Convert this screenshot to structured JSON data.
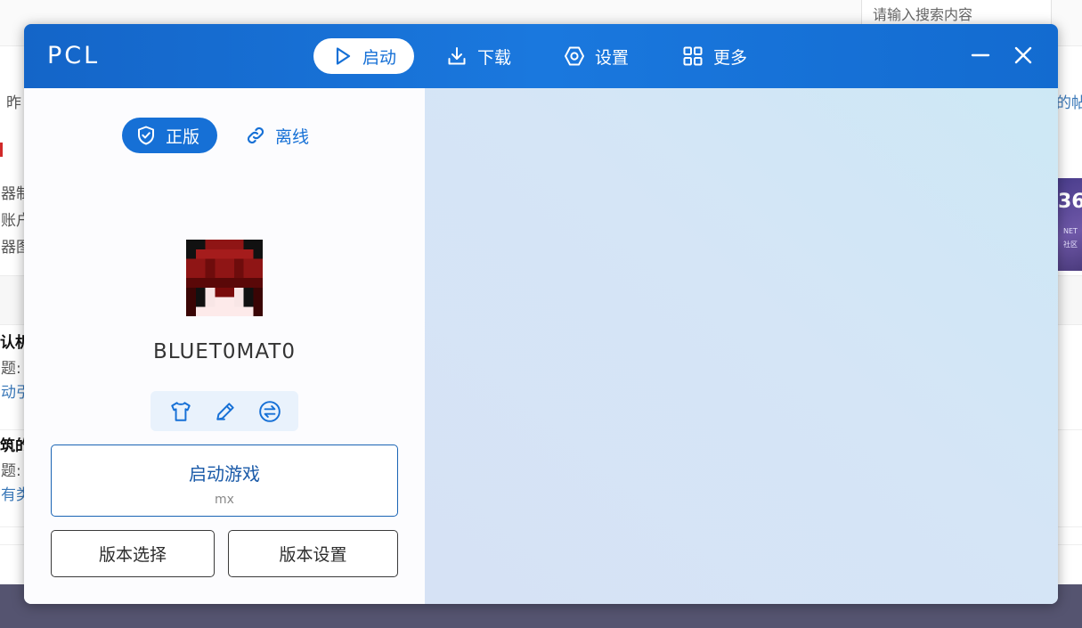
{
  "background_page": {
    "search_placeholder": "请输入搜索内容",
    "fragments": {
      "f1": "昨",
      "f2": "的帖",
      "f3": "器制",
      "f4": "账户",
      "f5": "器图",
      "f6": "认机",
      "f7": "题:",
      "f8": "动引",
      "f9": "筑的",
      "f10": "题:",
      "f11": "有类"
    },
    "ad": {
      "big": "36",
      "line1": "NET",
      "line2": "社区"
    }
  },
  "app": {
    "title": "PCL",
    "nav": [
      {
        "label": "启动",
        "icon": "play-icon",
        "active": true
      },
      {
        "label": "下载",
        "icon": "download-icon",
        "active": false
      },
      {
        "label": "设置",
        "icon": "settings-icon",
        "active": false
      },
      {
        "label": "更多",
        "icon": "grid-icon",
        "active": false
      }
    ],
    "login_tabs": [
      {
        "label": "正版",
        "icon": "shield-check-icon",
        "active": true
      },
      {
        "label": "离线",
        "icon": "link-icon",
        "active": false
      }
    ],
    "username": "BLUET0MAT0",
    "profile_tools": [
      "shirt-icon",
      "pencil-icon",
      "switch-icon"
    ],
    "launch": {
      "title": "启动游戏",
      "version": "mx"
    },
    "version_select_label": "版本选择",
    "version_settings_label": "版本设置",
    "colors": {
      "accent": "#1670d6",
      "titlebar": "#1a78de",
      "right_panel": "#d5e5f6"
    }
  }
}
